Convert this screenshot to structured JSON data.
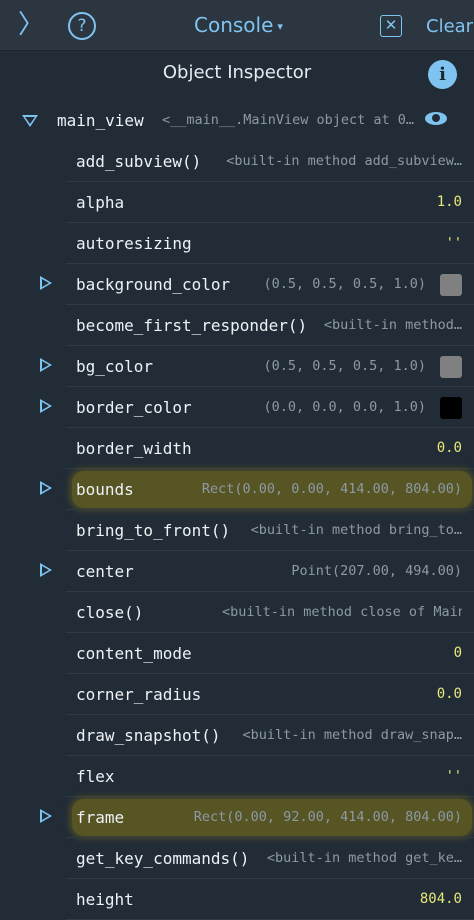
{
  "topbar": {
    "back_glyph": "〉",
    "help_glyph": "?",
    "title": "Console",
    "title_caret": "▾",
    "clear_box_glyph": "✕",
    "clear_label": "Clear"
  },
  "inspector": {
    "title": "Object Inspector",
    "info_glyph": "i",
    "root": {
      "name": "main_view",
      "value": "<__main__.MainView object at 0…"
    },
    "rows": [
      {
        "name": "add_subview()",
        "value": "<built-in method add_subview…",
        "kind": "method",
        "expandable": false
      },
      {
        "name": "alpha",
        "value": "1.0",
        "kind": "num",
        "expandable": false
      },
      {
        "name": "autoresizing",
        "value": "''",
        "kind": "str",
        "expandable": false
      },
      {
        "name": "background_color",
        "value": "(0.5, 0.5, 0.5, 1.0)",
        "kind": "color",
        "color": "#808080",
        "expandable": true
      },
      {
        "name": "become_first_responder()",
        "value": "<built-in method…",
        "kind": "method",
        "expandable": false
      },
      {
        "name": "bg_color",
        "value": "(0.5, 0.5, 0.5, 1.0)",
        "kind": "color",
        "color": "#808080",
        "expandable": true
      },
      {
        "name": "border_color",
        "value": "(0.0, 0.0, 0.0, 1.0)",
        "kind": "color",
        "color": "#000000",
        "expandable": true
      },
      {
        "name": "border_width",
        "value": "0.0",
        "kind": "num",
        "expandable": false
      },
      {
        "name": "bounds",
        "value": "Rect(0.00, 0.00, 414.00, 804.00)",
        "kind": "plain",
        "expandable": true,
        "highlight": true
      },
      {
        "name": "bring_to_front()",
        "value": "<built-in method bring_to…",
        "kind": "method",
        "expandable": false
      },
      {
        "name": "center",
        "value": "Point(207.00, 494.00)",
        "kind": "plain",
        "expandable": true
      },
      {
        "name": "close()",
        "value": "<built-in method close of MainView o…",
        "kind": "method",
        "expandable": false
      },
      {
        "name": "content_mode",
        "value": "0",
        "kind": "num",
        "expandable": false
      },
      {
        "name": "corner_radius",
        "value": "0.0",
        "kind": "num",
        "expandable": false
      },
      {
        "name": "draw_snapshot()",
        "value": "<built-in method draw_snap…",
        "kind": "method",
        "expandable": false
      },
      {
        "name": "flex",
        "value": "''",
        "kind": "str",
        "expandable": false
      },
      {
        "name": "frame",
        "value": "Rect(0.00, 92.00, 414.00, 804.00)",
        "kind": "plain",
        "expandable": true,
        "highlight": true
      },
      {
        "name": "get_key_commands()",
        "value": "<built-in method get_ke…",
        "kind": "method",
        "expandable": false
      },
      {
        "name": "height",
        "value": "804.0",
        "kind": "num",
        "expandable": false
      }
    ]
  },
  "colors": {
    "accent": "#7fc4f0",
    "background": "#222c36",
    "number": "#e7e77a",
    "highlight": "#5d5a22"
  }
}
